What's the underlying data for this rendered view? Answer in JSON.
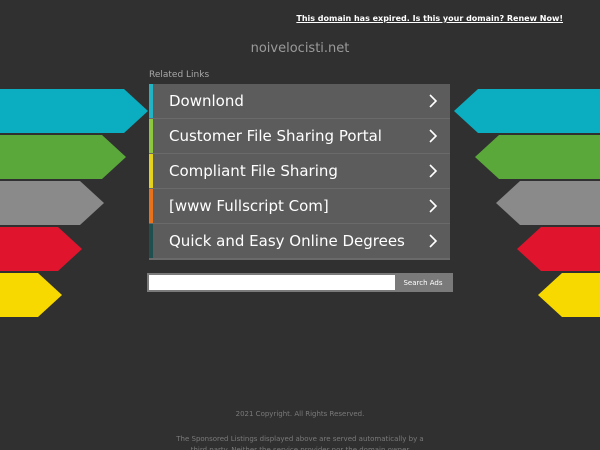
{
  "header": {
    "expired_notice": "This domain has expired. Is this your domain? Renew Now!",
    "domain": "noivelocisti.net"
  },
  "related": {
    "label": "Related Links",
    "links": [
      {
        "label": "Downlond",
        "accent": "#22b3c5"
      },
      {
        "label": "Customer File Sharing Portal",
        "accent": "#8dc63f"
      },
      {
        "label": "Compliant File Sharing",
        "accent": "#e5d21d"
      },
      {
        "label": "[www Fullscript Com]",
        "accent": "#e8711c"
      },
      {
        "label": "Quick and Easy Online Degrees",
        "accent": "#1f4f4f"
      }
    ]
  },
  "search": {
    "placeholder": "",
    "button_label": "Search Ads"
  },
  "footer": {
    "copyright": "2021 Copyright. All Rights Reserved.",
    "disclaimer": "The Sponsored Listings displayed above are served automatically by a third party. Neither the service provider nor the domain owner"
  },
  "colors": {
    "background": "#303030",
    "arrow_cyan": "#0aaec0",
    "arrow_green": "#5aa83a",
    "arrow_gray": "#8a8a8a",
    "arrow_red": "#e0152d",
    "arrow_yellow": "#f7d900"
  },
  "icons": {
    "link_chevron": "chevron-right-icon"
  }
}
